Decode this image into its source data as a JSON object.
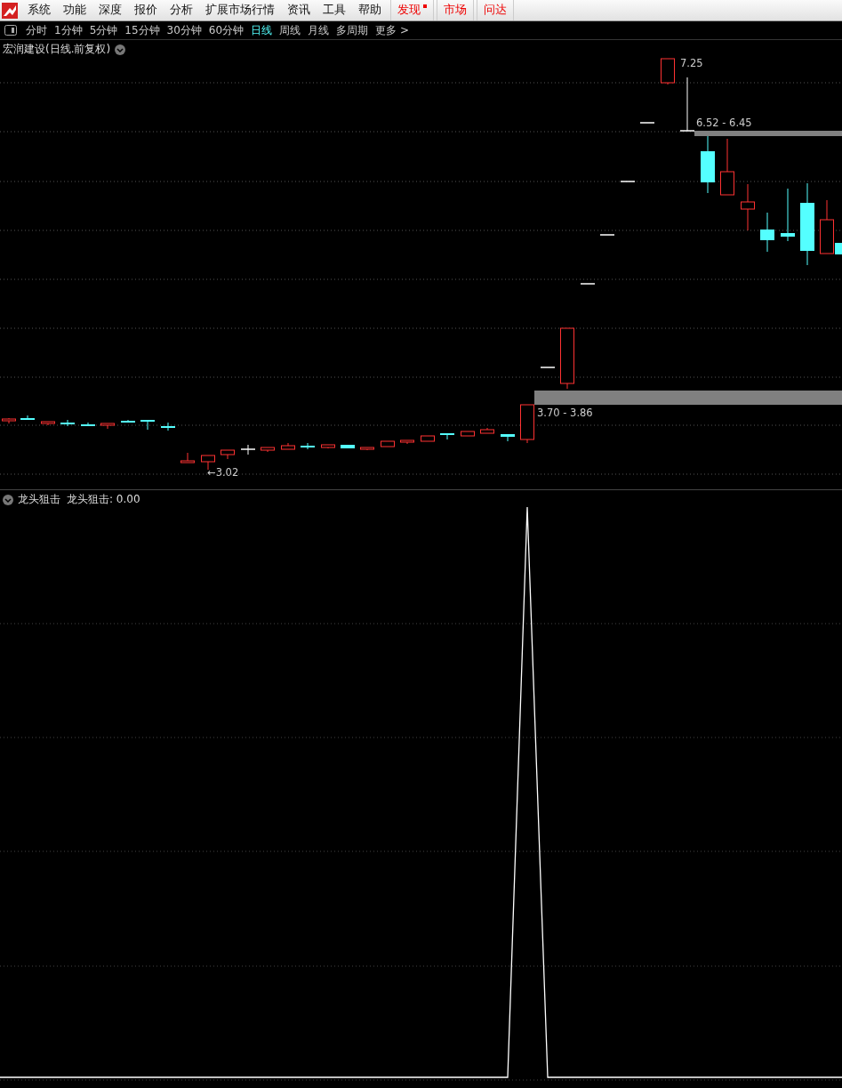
{
  "menu": [
    {
      "label": "系统",
      "kind": "plain"
    },
    {
      "label": "功能",
      "kind": "plain"
    },
    {
      "label": "深度",
      "kind": "plain"
    },
    {
      "label": "报价",
      "kind": "plain"
    },
    {
      "label": "分析",
      "kind": "plain"
    },
    {
      "label": "扩展市场行情",
      "kind": "plain"
    },
    {
      "label": "资讯",
      "kind": "plain"
    },
    {
      "label": "工具",
      "kind": "plain"
    },
    {
      "label": "帮助",
      "kind": "plain"
    },
    {
      "label": "发现",
      "kind": "highlight",
      "badge": true
    },
    {
      "label": "市场",
      "kind": "highlight",
      "badge": false
    },
    {
      "label": "问达",
      "kind": "highlight",
      "badge": false
    }
  ],
  "periods": [
    {
      "label": "分时",
      "selected": false
    },
    {
      "label": "1分钟",
      "selected": false
    },
    {
      "label": "5分钟",
      "selected": false
    },
    {
      "label": "15分钟",
      "selected": false
    },
    {
      "label": "30分钟",
      "selected": false
    },
    {
      "label": "60分钟",
      "selected": false
    },
    {
      "label": "日线",
      "selected": true
    },
    {
      "label": "周线",
      "selected": false
    },
    {
      "label": "月线",
      "selected": false
    },
    {
      "label": "多周期",
      "selected": false
    },
    {
      "label": "更多 >",
      "selected": false
    }
  ],
  "main_chart": {
    "title": "宏润建设(日线.前复权)",
    "high_label": "7.25",
    "low_label": "←3.02",
    "gaps": [
      {
        "label": "6.52 - 6.45"
      },
      {
        "label": "3.70 - 3.86"
      }
    ]
  },
  "indicator": {
    "name": "龙头狙击",
    "reading": "龙头狙击: 0.00"
  }
}
